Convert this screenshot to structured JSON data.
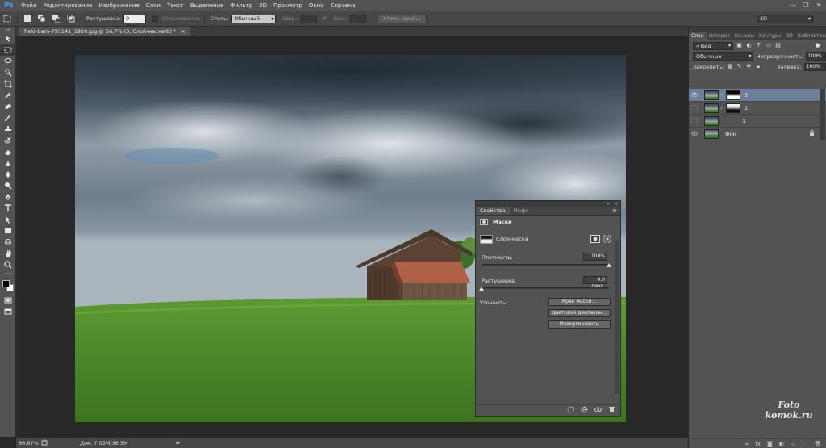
{
  "app": {
    "logo": "Ps"
  },
  "menu": [
    "Файл",
    "Редактирование",
    "Изображение",
    "Слои",
    "Текст",
    "Выделение",
    "Фильтр",
    "3D",
    "Просмотр",
    "Окно",
    "Справка"
  ],
  "window_controls": [
    "—",
    "❐",
    "✕"
  ],
  "options": {
    "feather_label": "Растушевка:",
    "feather_value": "0 пикс.",
    "antialias_label": "Сглаживание",
    "style_label": "Стиль:",
    "style_value": "Обычный",
    "width_label": "Шир.:",
    "height_label": "Выс.:",
    "refine_button": "Уточн. край...",
    "workspace": "3D"
  },
  "document": {
    "tab_title": "field-barn-795141_1920.jpg @ 66,7% (3, Слой-маска/8) *",
    "tab_close": "×"
  },
  "status": {
    "zoom": "66,67%",
    "doc_info": "Док: 7,03M/36,5M"
  },
  "properties": {
    "tabs": [
      "Свойства",
      "Инфо"
    ],
    "menu_icon": "≡",
    "title": "Маски",
    "mask_row_label": "Слой-маска",
    "density_label": "Плотность:",
    "density_value": "100%",
    "density_fraction": 1.0,
    "feather_label": "Растушевка:",
    "feather_value": "0,0 пикс.",
    "feather_fraction": 0.0,
    "refine_label": "Уточнить:",
    "buttons": [
      "Край маски...",
      "Цветовой диапазон...",
      "Инвертировать"
    ]
  },
  "layers": {
    "tabs": [
      "Слои",
      "История",
      "Каналы",
      "Контуры",
      "3D",
      "Библиотеки"
    ],
    "filter_label": "Вид",
    "blend_mode": "Обычные",
    "opacity_label": "Непрозрачность:",
    "opacity_value": "100%",
    "lock_label": "Закрепить:",
    "fill_label": "Заливка:",
    "fill_value": "100%",
    "items": [
      {
        "name": "3",
        "visible": true,
        "selected": true,
        "has_mask": true,
        "mask_style": "mask"
      },
      {
        "name": "2",
        "visible": false,
        "selected": false,
        "has_mask": true,
        "mask_style": "mask2"
      },
      {
        "name": "1",
        "visible": false,
        "selected": false,
        "has_mask": false
      },
      {
        "name": "Фон",
        "visible": true,
        "selected": false,
        "has_mask": false,
        "locked": true
      }
    ]
  },
  "watermark": {
    "line1": "Foto",
    "line2": "komok.ru"
  }
}
